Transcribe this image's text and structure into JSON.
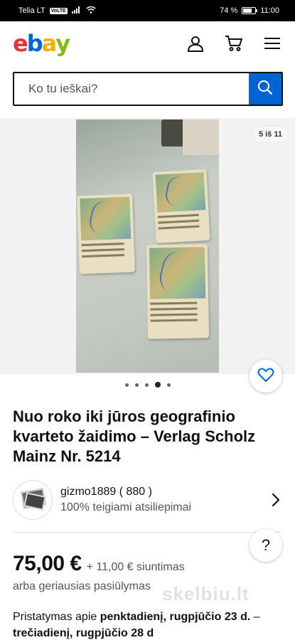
{
  "status_bar": {
    "carrier": "Telia LT",
    "network_badge": "VoLTE",
    "battery_percent": "74 %",
    "battery_level": 0.74,
    "time": "11:00"
  },
  "header": {
    "logo_letters": [
      {
        "char": "e",
        "color": "#e53238"
      },
      {
        "char": "b",
        "color": "#0064d2"
      },
      {
        "char": "a",
        "color": "#f5af02"
      },
      {
        "char": "y",
        "color": "#86b817"
      }
    ],
    "icons": [
      "user-icon",
      "cart-icon",
      "menu-icon"
    ]
  },
  "search": {
    "placeholder": "Ko tu ieškai?",
    "button_icon": "search-icon"
  },
  "gallery": {
    "counter": "5 iš 11",
    "dot_count": 5,
    "active_dot": 3,
    "favorite_icon": "heart-icon"
  },
  "item": {
    "title": "Nuo roko iki jūros geografinio kvarteto žaidimo – Verlag Scholz Mainz Nr. 5214"
  },
  "seller": {
    "name": "gizmo1889 ( 880 )",
    "feedback": "100% teigiami atsiliepimai"
  },
  "price": {
    "amount": "75,00 €",
    "shipping": "+ 11,00 € siuntimas",
    "best_offer": "arba geriausias pasiūlymas"
  },
  "help": {
    "label": "?"
  },
  "watermark": "skelbiu.lt",
  "delivery": {
    "prefix": "Pristatymas apie ",
    "from": "penktadienį, rugpjūčio 23 d.",
    "separator": " – ",
    "to": "trečiadienį, rugpjūčio 28 d"
  },
  "colors": {
    "accent_blue": "#0064d2"
  }
}
